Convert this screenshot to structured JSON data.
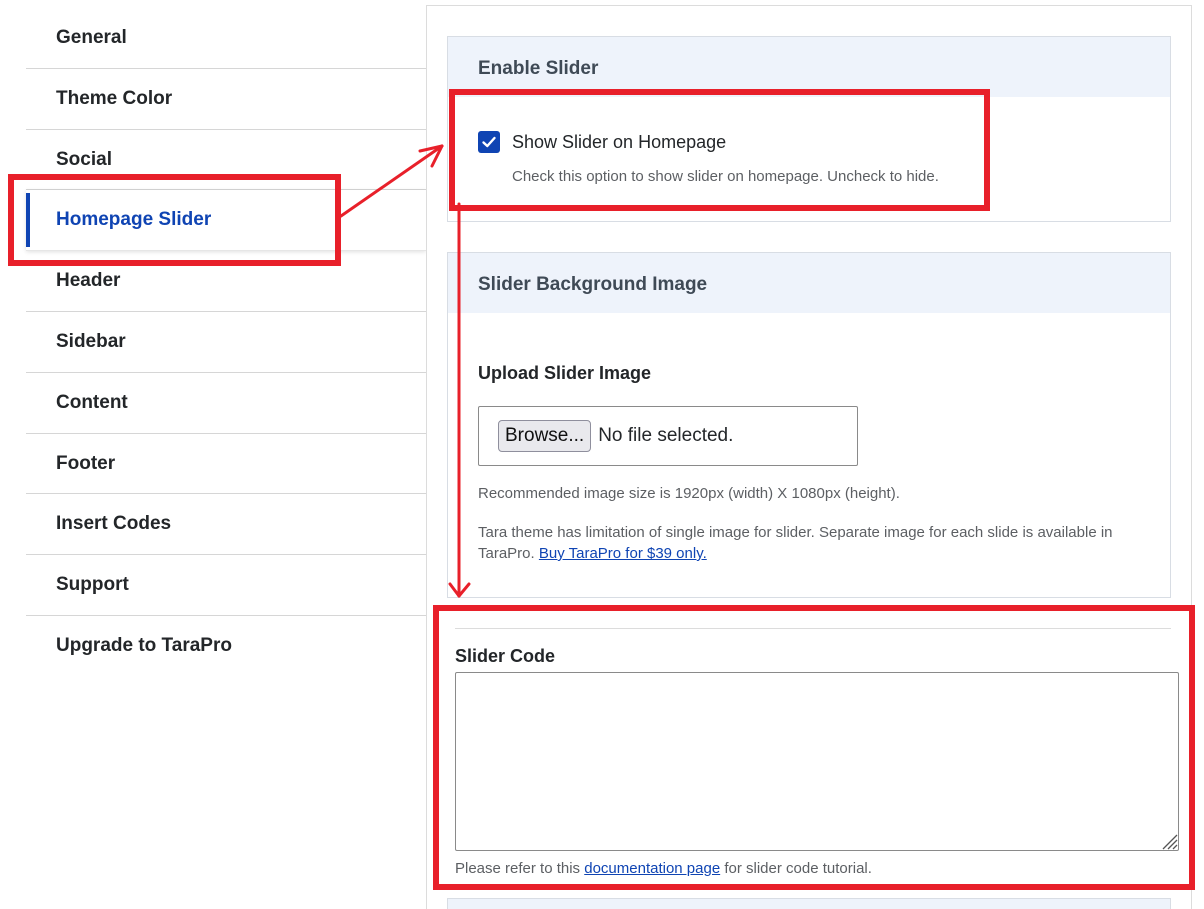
{
  "sidebar": {
    "items": [
      {
        "label": "General"
      },
      {
        "label": "Theme Color"
      },
      {
        "label": "Social"
      },
      {
        "label": "Homepage Slider",
        "active": true
      },
      {
        "label": "Header"
      },
      {
        "label": "Sidebar"
      },
      {
        "label": "Content"
      },
      {
        "label": "Footer"
      },
      {
        "label": "Insert Codes"
      },
      {
        "label": "Support"
      },
      {
        "label": "Upgrade to TaraPro"
      }
    ]
  },
  "enable_slider": {
    "heading": "Enable Slider",
    "checkbox_label": "Show Slider on Homepage",
    "checked": true,
    "description": "Check this option to show slider on homepage. Uncheck to hide."
  },
  "background": {
    "heading": "Slider Background Image",
    "upload_label": "Upload Slider Image",
    "browse_label": "Browse...",
    "file_status": "No file selected.",
    "recommended": "Recommended image size is 1920px (width) X 1080px (height).",
    "limitation_text": "Tara theme has limitation of single image for slider. Separate image for each slide is available in TaraPro.",
    "buy_link": "Buy TaraPro for $39 only."
  },
  "slider_code": {
    "label": "Slider Code",
    "value": "",
    "help_prefix": "Please refer to this",
    "help_link": "documentation page",
    "help_suffix": "for slider code tutorial."
  },
  "colors": {
    "accent": "#0f44b3",
    "annotation": "#e8202a",
    "card_header_bg": "#eef3fb"
  }
}
